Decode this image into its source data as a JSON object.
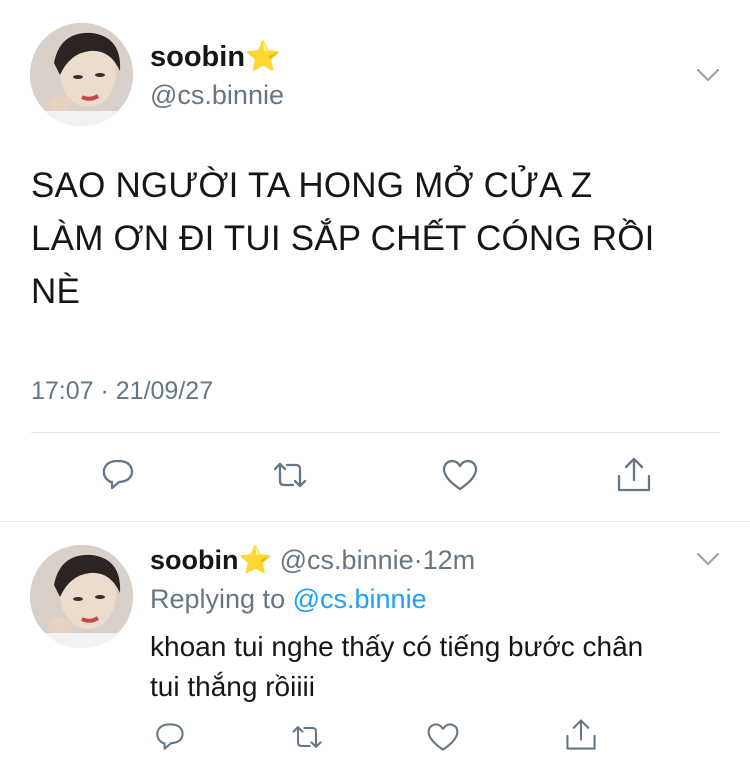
{
  "tweet": {
    "display_name": "soobin",
    "badge_emoji": "⭐",
    "handle": "@cs.binnie",
    "text_lines": [
      "SAO NGƯỜI TA HONG MỞ CỬA Z",
      "LÀM ƠN ĐI TUI SẮP CHẾT CÓNG RỒI",
      "NÈ"
    ],
    "timestamp": "17:07 · 21/09/27"
  },
  "reply": {
    "display_name": "soobin",
    "badge_emoji": "⭐",
    "handle": "@cs.binnie",
    "dot": "·",
    "time_ago": "12m",
    "replying_prefix": "Replying to",
    "replying_to": "@cs.binnie",
    "text_lines": [
      "khoan tui nghe thấy có tiếng bước chân",
      "tui thắng rồiiii"
    ]
  },
  "icons": {
    "menu": "chevron-down-icon",
    "reply": "speech-bubble-icon",
    "retweet": "retweet-icon",
    "like": "heart-icon",
    "share": "share-icon"
  },
  "colors": {
    "text": "#14171a",
    "secondary": "#657786",
    "link": "#1da1f2",
    "divider": "#e1e8ed"
  }
}
